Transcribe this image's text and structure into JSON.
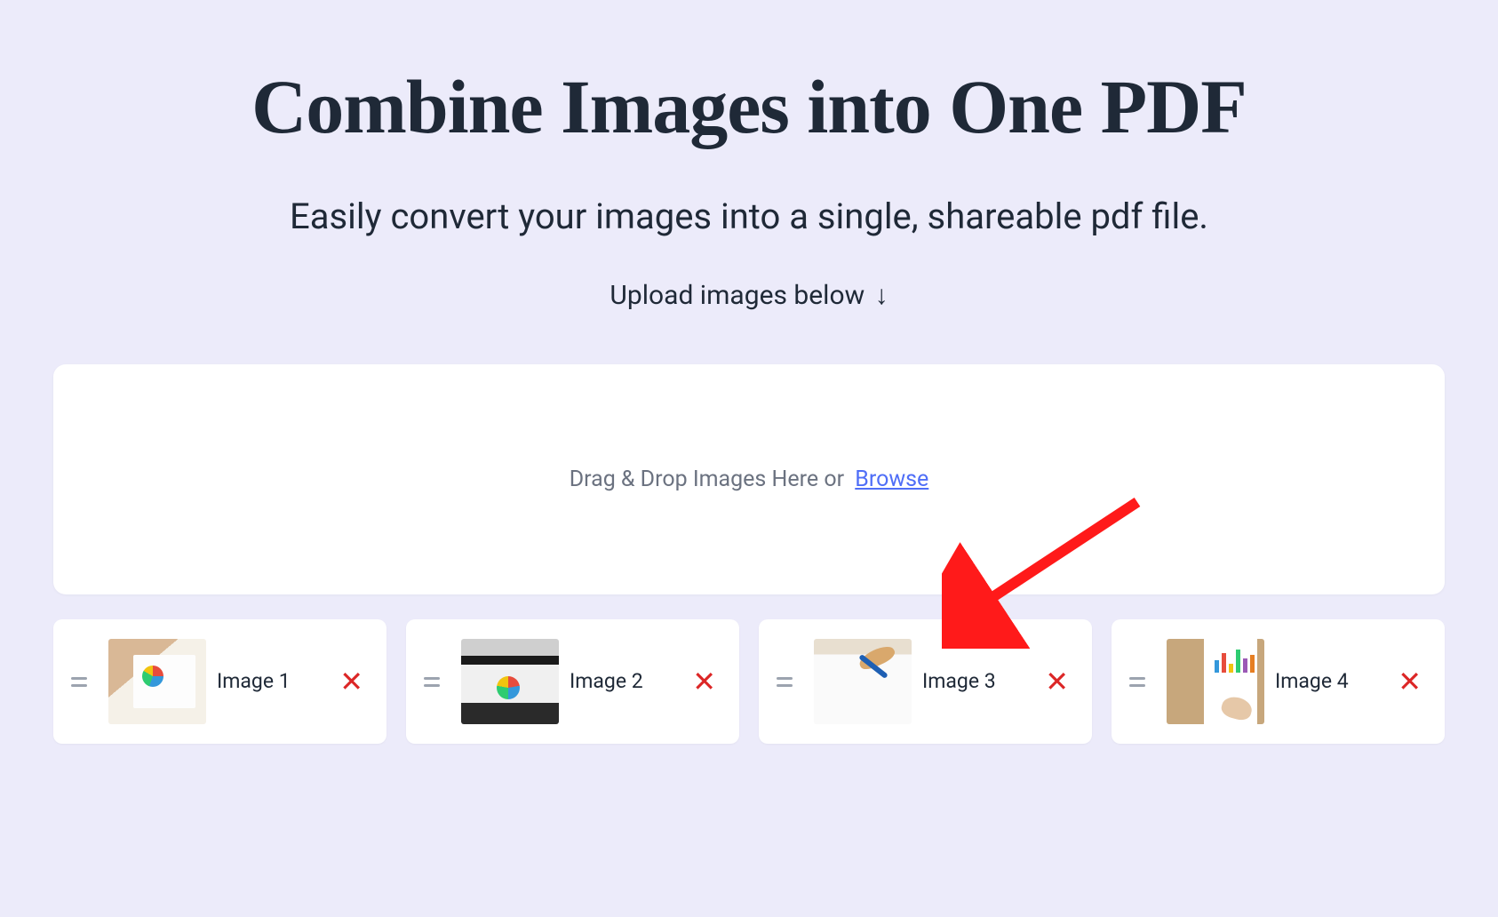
{
  "header": {
    "title": "Combine Images into One PDF",
    "subtitle": "Easily convert your images into a single, shareable pdf file.",
    "instruction": "Upload images below",
    "instruction_arrow": "↓"
  },
  "dropzone": {
    "text": "Drag & Drop Images Here or",
    "browse_label": "Browse"
  },
  "images": [
    {
      "label": "Image 1",
      "thumb_class": "thumb1"
    },
    {
      "label": "Image 2",
      "thumb_class": "thumb2"
    },
    {
      "label": "Image 3",
      "thumb_class": "thumb3"
    },
    {
      "label": "Image 4",
      "thumb_class": "thumb4"
    }
  ],
  "icons": {
    "remove": "✕"
  },
  "colors": {
    "background": "#ecebfa",
    "card_bg": "#ffffff",
    "text_primary": "#1f2937",
    "text_secondary": "#6b7280",
    "link": "#4f6ef7",
    "remove": "#dc2626",
    "annotation": "#ff1a1a"
  }
}
